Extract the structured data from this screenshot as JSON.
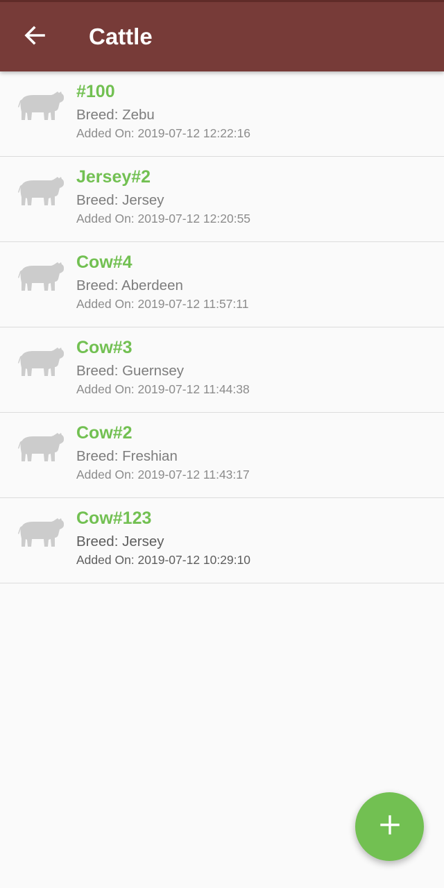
{
  "app_bar": {
    "title": "Cattle",
    "back_icon": "arrow-left-icon",
    "color": "#773b38"
  },
  "cattle": [
    {
      "name": "#100",
      "breed": "Breed: Zebu",
      "added": "Added On: 2019-07-12 12:22:16"
    },
    {
      "name": "Jersey#2",
      "breed": "Breed: Jersey",
      "added": "Added On: 2019-07-12 12:20:55"
    },
    {
      "name": "Cow#4",
      "breed": "Breed: Aberdeen",
      "added": "Added On: 2019-07-12 11:57:11"
    },
    {
      "name": "Cow#3",
      "breed": "Breed: Guernsey",
      "added": "Added On: 2019-07-12 11:44:38"
    },
    {
      "name": "Cow#2",
      "breed": "Breed: Freshian",
      "added": "Added On: 2019-07-12 11:43:17"
    },
    {
      "name": "Cow#123",
      "breed": "Breed: Jersey",
      "added": "Added On: 2019-07-12 10:29:10"
    }
  ],
  "list_icon": "cow-icon",
  "fab": {
    "icon": "plus-icon",
    "color": "#72c052"
  },
  "colors": {
    "name_text": "#72c052",
    "detail_text": "#7d7d7d",
    "icon_gray": "#cccccc"
  }
}
